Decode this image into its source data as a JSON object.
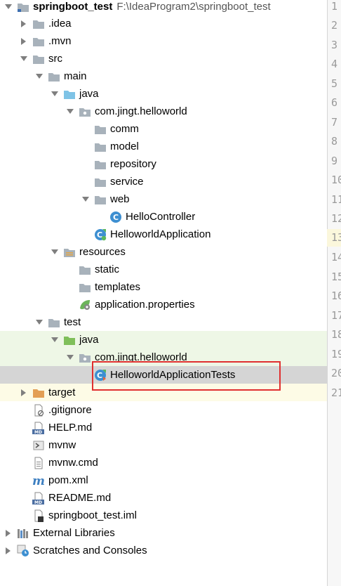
{
  "project": {
    "name": "springboot_test",
    "path": "F:\\IdeaProgram2\\springboot_test"
  },
  "tree": {
    "idea": ".idea",
    "mvn": ".mvn",
    "src": "src",
    "main": "main",
    "java": "java",
    "pkg": "com.jingt.helloworld",
    "comm": "comm",
    "model": "model",
    "repository": "repository",
    "service": "service",
    "web": "web",
    "hello_controller": "HelloController",
    "app": "HelloworldApplication",
    "resources": "resources",
    "static": "static",
    "templates": "templates",
    "app_props": "application.properties",
    "test": "test",
    "test_java": "java",
    "test_pkg": "com.jingt.helloworld",
    "app_tests": "HelloworldApplicationTests",
    "target": "target",
    "gitignore": ".gitignore",
    "help": "HELP.md",
    "mvnw": "mvnw",
    "mvnw_cmd": "mvnw.cmd",
    "pom": "pom.xml",
    "readme": "README.md",
    "iml": "springboot_test.iml",
    "ext_libs": "External Libraries",
    "scratches": "Scratches and Consoles"
  },
  "gutter": {
    "lines": [
      "1",
      "2",
      "3",
      "4",
      "5",
      "6",
      "7",
      "8",
      "9",
      "10",
      "11",
      "12",
      "13",
      "14",
      "15",
      "16",
      "17",
      "18",
      "19",
      "20",
      "21"
    ]
  },
  "colors": {
    "folder": "#a8b2bb",
    "source_folder": "#7ec3e6",
    "test_folder": "#7fbf5a",
    "excluded_folder": "#e39f56",
    "class_icon": "#3d8fd1",
    "selection": "#d5d5d5",
    "highlight_box": "#e03030"
  }
}
